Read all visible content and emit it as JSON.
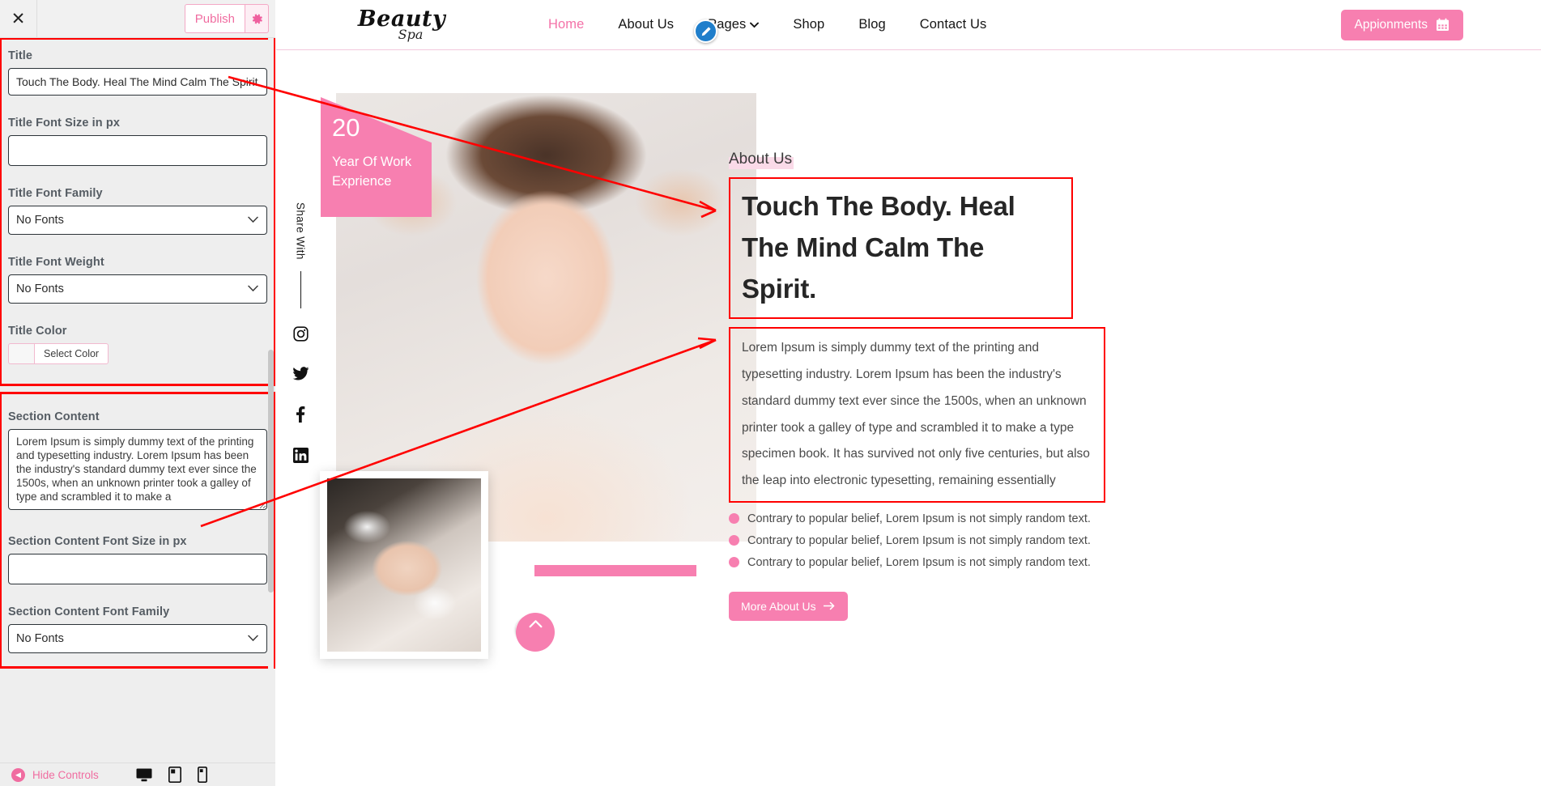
{
  "customizer": {
    "close_icon": "close-icon",
    "publish_label": "Publish",
    "gear_icon": "gear-icon",
    "groups": [
      {
        "name": "title-group",
        "fields": [
          {
            "label": "Title",
            "type": "text",
            "value": "Touch The Body. Heal The Mind Calm The Spirit."
          },
          {
            "label": "Title Font Size in px",
            "type": "text",
            "value": ""
          },
          {
            "label": "Title Font Family",
            "type": "select",
            "value": "No Fonts"
          },
          {
            "label": "Title Font Weight",
            "type": "select",
            "value": "No Fonts"
          },
          {
            "label": "Title Color",
            "type": "color",
            "value": "Select Color"
          }
        ]
      },
      {
        "name": "section-content-group",
        "fields": [
          {
            "label": "Section Content",
            "type": "textarea",
            "value": "Lorem Ipsum is simply dummy text of the printing and typesetting industry. Lorem Ipsum has been the industry's standard dummy text ever since the 1500s, when an unknown printer took a galley of type and scrambled it to make a"
          },
          {
            "label": "Section Content Font Size in px",
            "type": "text",
            "value": ""
          },
          {
            "label": "Section Content Font Family",
            "type": "select",
            "value": "No Fonts"
          }
        ]
      }
    ],
    "footer": {
      "hide_controls_label": "Hide Controls",
      "back_arrow_icon": "chevron-left-icon",
      "devices": [
        "desktop-icon",
        "tablet-icon",
        "mobile-icon"
      ]
    }
  },
  "site": {
    "logo": {
      "main": "Beauty",
      "sub": "Spa"
    },
    "nav": [
      {
        "label": "Home",
        "active": true,
        "caret": false
      },
      {
        "label": "About Us",
        "active": false,
        "caret": false
      },
      {
        "label": "Pages",
        "active": false,
        "caret": true
      },
      {
        "label": "Shop",
        "active": false,
        "caret": false
      },
      {
        "label": "Blog",
        "active": false,
        "caret": false
      },
      {
        "label": "Contact Us",
        "active": false,
        "caret": false
      }
    ],
    "appointments_button": {
      "label": "Appionments",
      "icon": "calendar-icon"
    },
    "share_rail": {
      "label": "Share With",
      "icons": [
        "instagram-icon",
        "twitter-icon",
        "facebook-icon",
        "linkedin-icon"
      ]
    },
    "badge": {
      "number": "20",
      "line1": "Year Of Work",
      "line2": "Exprience"
    },
    "about": {
      "eyebrow": "About Us",
      "title": "Touch The Body. Heal The Mind Calm The Spirit.",
      "body": "Lorem Ipsum is simply dummy text of the printing and typesetting industry. Lorem Ipsum has been the industry's standard dummy text ever since the 1500s, when an unknown printer took a galley of type and scrambled it to make a type specimen book. It has survived not only five centuries, but also the leap into electronic typesetting, remaining essentially",
      "bullets": [
        "Contrary to popular belief, Lorem Ipsum is not simply random text.",
        "Contrary to popular belief, Lorem Ipsum is not simply random text.",
        "Contrary to popular belief, Lorem Ipsum is not simply random text."
      ],
      "cta": {
        "label": "More About Us",
        "icon": "arrow-right-icon"
      }
    }
  },
  "colors": {
    "accent_pink": "#f77fb0",
    "nav_active": "#f472a8",
    "annotation_red": "#ff0000",
    "edit_blue": "#1f7ecb",
    "panel_bg": "#eeeeee"
  }
}
